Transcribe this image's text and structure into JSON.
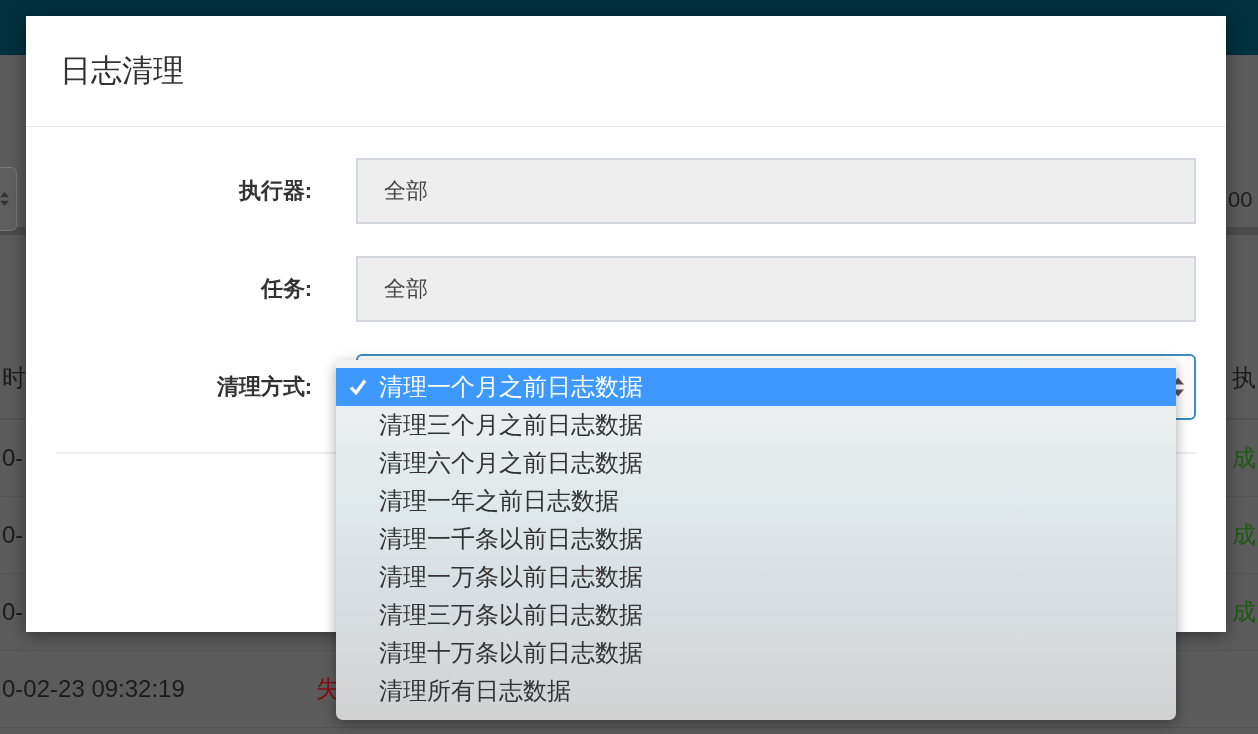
{
  "background": {
    "filter_row": {
      "right_text": "00"
    },
    "table": {
      "header": {
        "left": "时",
        "right": "执"
      },
      "rows": [
        {
          "time": "0-",
          "column_last": "成",
          "color": "#1d5a12"
        },
        {
          "time": "0-",
          "column_last": "成",
          "color": "#1d5a12"
        },
        {
          "time": "0-",
          "column_last": "成",
          "color": "#1d5a12"
        },
        {
          "time": "0-02-23 09:32:19",
          "column_2": "失",
          "color": "#8a0c0c"
        }
      ]
    }
  },
  "dialog": {
    "title": "日志清理",
    "fields": [
      {
        "label": "执行器:",
        "kind": "readonly",
        "value": "全部"
      },
      {
        "label": "任务:",
        "kind": "readonly",
        "value": "全部"
      },
      {
        "label": "清理方式:",
        "kind": "select",
        "open": true
      }
    ],
    "dropdown": {
      "options": [
        {
          "label": "清理一个月之前日志数据",
          "selected": true
        },
        {
          "label": "清理三个月之前日志数据",
          "selected": false
        },
        {
          "label": "清理六个月之前日志数据",
          "selected": false
        },
        {
          "label": "清理一年之前日志数据",
          "selected": false
        },
        {
          "label": "清理一千条以前日志数据",
          "selected": false
        },
        {
          "label": "清理一万条以前日志数据",
          "selected": false
        },
        {
          "label": "清理三万条以前日志数据",
          "selected": false
        },
        {
          "label": "清理十万条以前日志数据",
          "selected": false
        },
        {
          "label": "清理所有日志数据",
          "selected": false
        }
      ]
    }
  }
}
